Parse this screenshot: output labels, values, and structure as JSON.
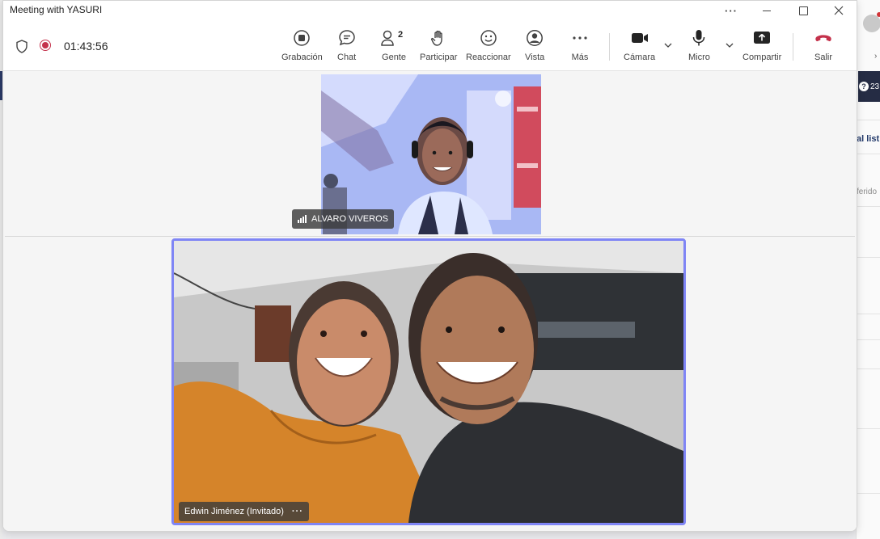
{
  "window": {
    "title": "Meeting with YASURI"
  },
  "toolbar": {
    "timer": "01:43:56",
    "buttons": {
      "recording": "Grabación",
      "chat": "Chat",
      "people": "Gente",
      "people_count": "2",
      "raise": "Participar",
      "react": "Reaccionar",
      "view": "Vista",
      "more": "Más",
      "camera": "Cámara",
      "mic": "Micro",
      "share": "Compartir",
      "leave": "Salir"
    }
  },
  "participants": [
    {
      "name": "ALVARO VIVEROS"
    },
    {
      "name": "Edwin Jiménez (Invitado)"
    }
  ],
  "background_app": {
    "help_count": "23",
    "heading": "al list",
    "text": "ferido"
  },
  "colors": {
    "accent": "#7f85f5",
    "record": "#c4314b",
    "leave": "#c4314b"
  }
}
